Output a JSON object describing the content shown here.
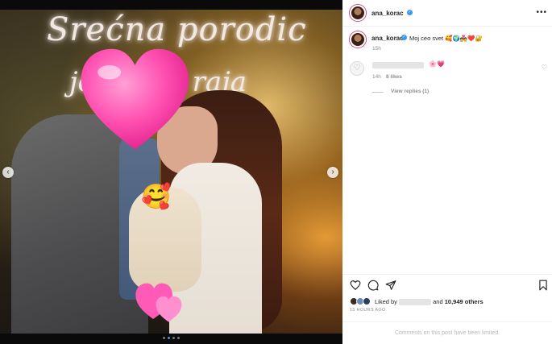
{
  "post": {
    "username": "ana_korac",
    "more_label": "•••"
  },
  "media": {
    "neon_line1": "Srećna porodic",
    "neon_line2": "je pobre raja",
    "nav_prev": "‹",
    "nav_next": "›",
    "carousel_count": 4,
    "carousel_active_index": 1
  },
  "caption": {
    "username": "ana_korac",
    "text": "Moj ceo svet 🥰🌍💑❤️🔐",
    "time": "15h"
  },
  "comment": {
    "emojis": "🌸💗",
    "time": "14h",
    "likes": "8 likes",
    "view_replies": "View replies (1)"
  },
  "engagement": {
    "liked_by_prefix": "Liked by",
    "liked_by_and": "and",
    "others": "10,949 others",
    "date": "15 HOURS AGO"
  },
  "footer": {
    "comments_limited": "Comments on this post have been limited."
  },
  "colors": {
    "accent": "#3897f0",
    "text": "#262626",
    "muted": "#8e8e8e",
    "story_ring": "#d63e7a"
  },
  "icons": {
    "like": "heart-outline-icon",
    "comment": "comment-bubble-icon",
    "share": "paper-plane-icon",
    "save": "bookmark-icon",
    "verified": "verified-badge-icon",
    "prev": "chevron-left-icon",
    "next": "chevron-right-icon"
  }
}
